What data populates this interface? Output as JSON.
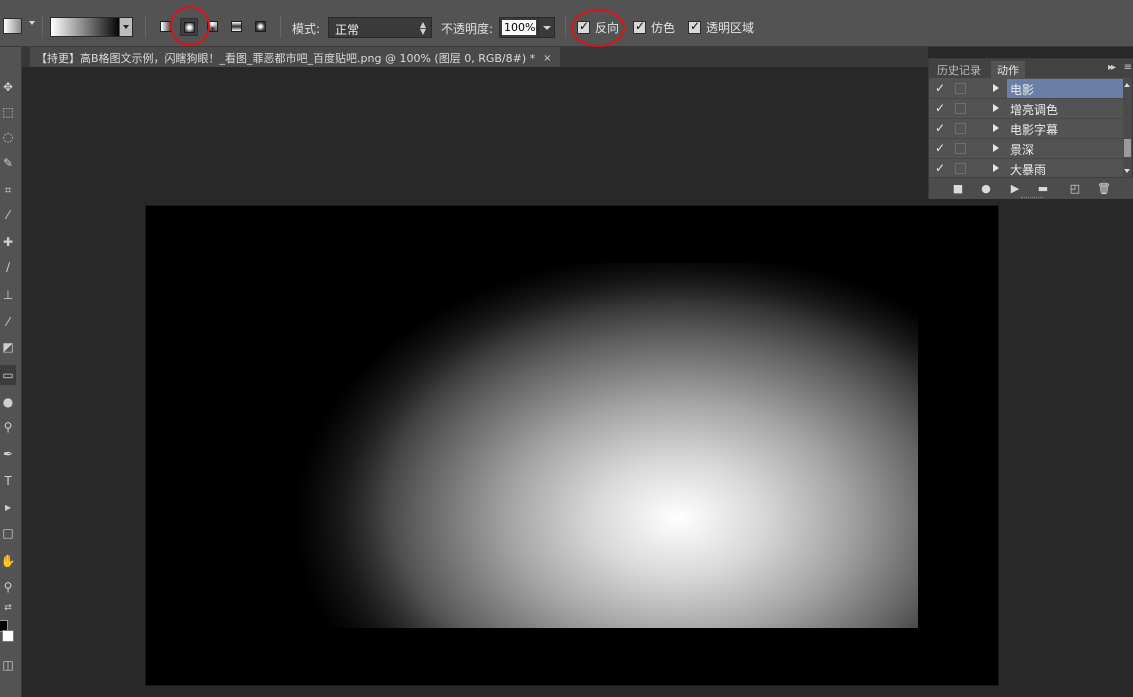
{
  "options_bar": {
    "mode_label": "模式:",
    "mode_value": "正常",
    "opacity_label": "不透明度:",
    "opacity_value": "100%",
    "reverse_label": "反向",
    "dither_label": "仿色",
    "transparency_label": "透明区域",
    "reverse_checked": true,
    "dither_checked": true,
    "transparency_checked": true,
    "active_gradient_type": "radial"
  },
  "document": {
    "tab_title": "【持更】高B格图文示例，闪瞎狗眼！_看图_罪恶都市吧_百度贴吧.png @ 100% (图层 0, RGB/8#) *",
    "close_glyph": "×"
  },
  "actions_panel": {
    "tabs": [
      "历史记录",
      "动作"
    ],
    "active_tab": "动作",
    "items": [
      {
        "label": "电影",
        "selected": true
      },
      {
        "label": "增亮调色",
        "selected": false
      },
      {
        "label": "电影字幕",
        "selected": false
      },
      {
        "label": "景深",
        "selected": false
      },
      {
        "label": "大暴雨",
        "selected": false
      }
    ],
    "check_glyph": "✓"
  },
  "colors": {
    "annotation_red": "#e0101a",
    "panel_gray": "#535353",
    "canvas_black": "#000000",
    "selection_blue": "#6a7fa6"
  }
}
